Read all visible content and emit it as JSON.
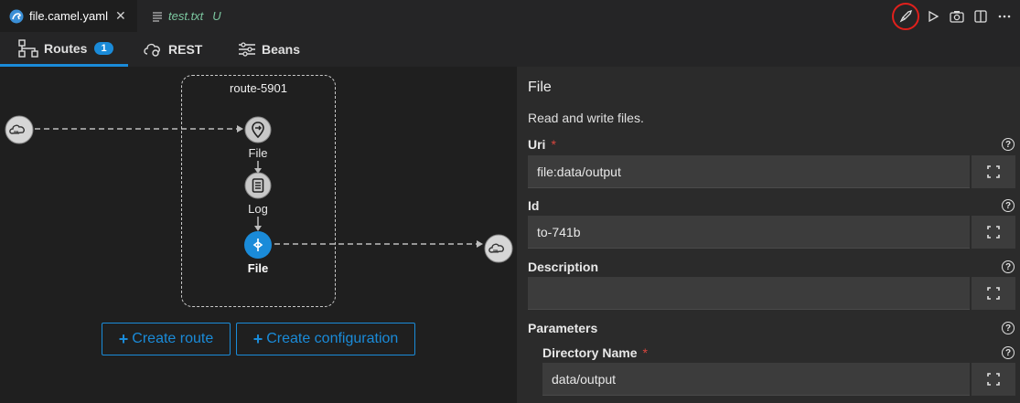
{
  "tabs": [
    {
      "label": "file.camel.yaml",
      "active": true
    },
    {
      "label": "test.txt",
      "status": "U",
      "active": false
    }
  ],
  "nav": {
    "routes_label": "Routes",
    "routes_count": "1",
    "rest_label": "REST",
    "beans_label": "Beans"
  },
  "canvas": {
    "route_title": "route-5901",
    "nodes": [
      "File",
      "Log",
      "File"
    ],
    "create_route": "Create route",
    "create_configuration": "Create configuration"
  },
  "panel": {
    "title": "File",
    "description": "Read and write files.",
    "fields": {
      "uri_label": "Uri",
      "uri_value": "file:data/output",
      "id_label": "Id",
      "id_value": "to-741b",
      "description_label": "Description",
      "description_value": "",
      "parameters_label": "Parameters",
      "directory_name_label": "Directory Name",
      "directory_name_value": "data/output"
    },
    "required_marker": "*",
    "help_glyph": "?"
  },
  "colors": {
    "accent": "#1a8bd9",
    "highlight_ring": "#e0201c",
    "required": "#d9463e"
  },
  "icons": [
    "camel-icon",
    "file-lines-icon",
    "close-icon",
    "rocket-icon",
    "run-icon",
    "camera-icon",
    "split-editor-icon",
    "more-icon",
    "routes-icon",
    "rest-icon",
    "beans-icon",
    "cloud-icon",
    "file-icon",
    "log-icon",
    "help-icon",
    "expand-icon"
  ]
}
